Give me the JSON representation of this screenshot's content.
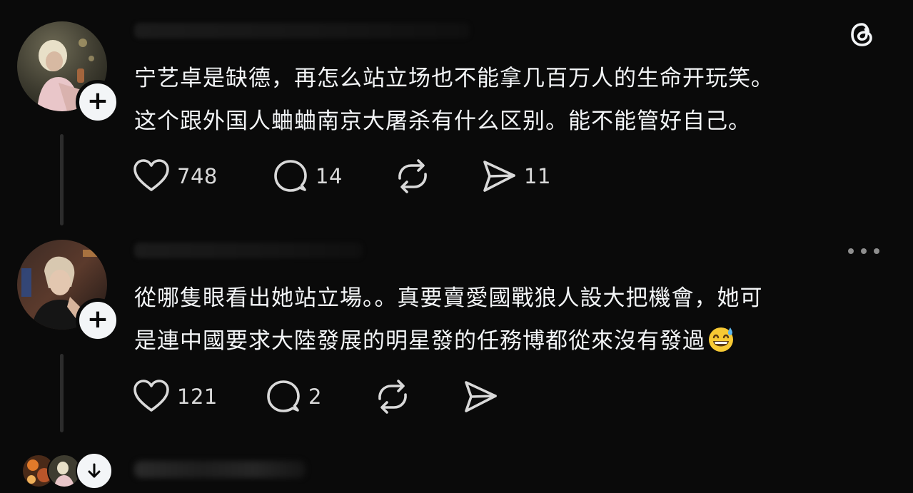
{
  "app": {
    "logo_icon": "threads-logo-icon"
  },
  "posts": [
    {
      "avatar_icon": "avatar-blonde",
      "follow_icon": "plus-icon",
      "text_lines": [
        "宁艺卓是缺德，再怎么站立场也不能拿几百万人的生命开玩笑。",
        "这个跟外国人蛐蛐南京大屠杀有什么区别。能不能管好自己。"
      ],
      "likes": "748",
      "replies": "14",
      "reposts": "",
      "shares": "11"
    },
    {
      "avatar_icon": "avatar-portrait",
      "follow_icon": "plus-icon",
      "more_icon": "more-icon",
      "text_lines": [
        "從哪隻眼看出她站立場。。真要賣愛國戰狼人設大把機會，她可",
        "是連中國要求大陸發展的明星發的任務博都從來沒有發過"
      ],
      "emoji": "grinning-face-with-sweat",
      "likes": "121",
      "replies": "2",
      "reposts": "",
      "shares": ""
    }
  ],
  "footer": {
    "expand_icon": "arrow-down-icon"
  },
  "colors": {
    "background": "#0a0a0a",
    "text": "#f3f5f7",
    "thread_line": "#2c2c2c"
  }
}
